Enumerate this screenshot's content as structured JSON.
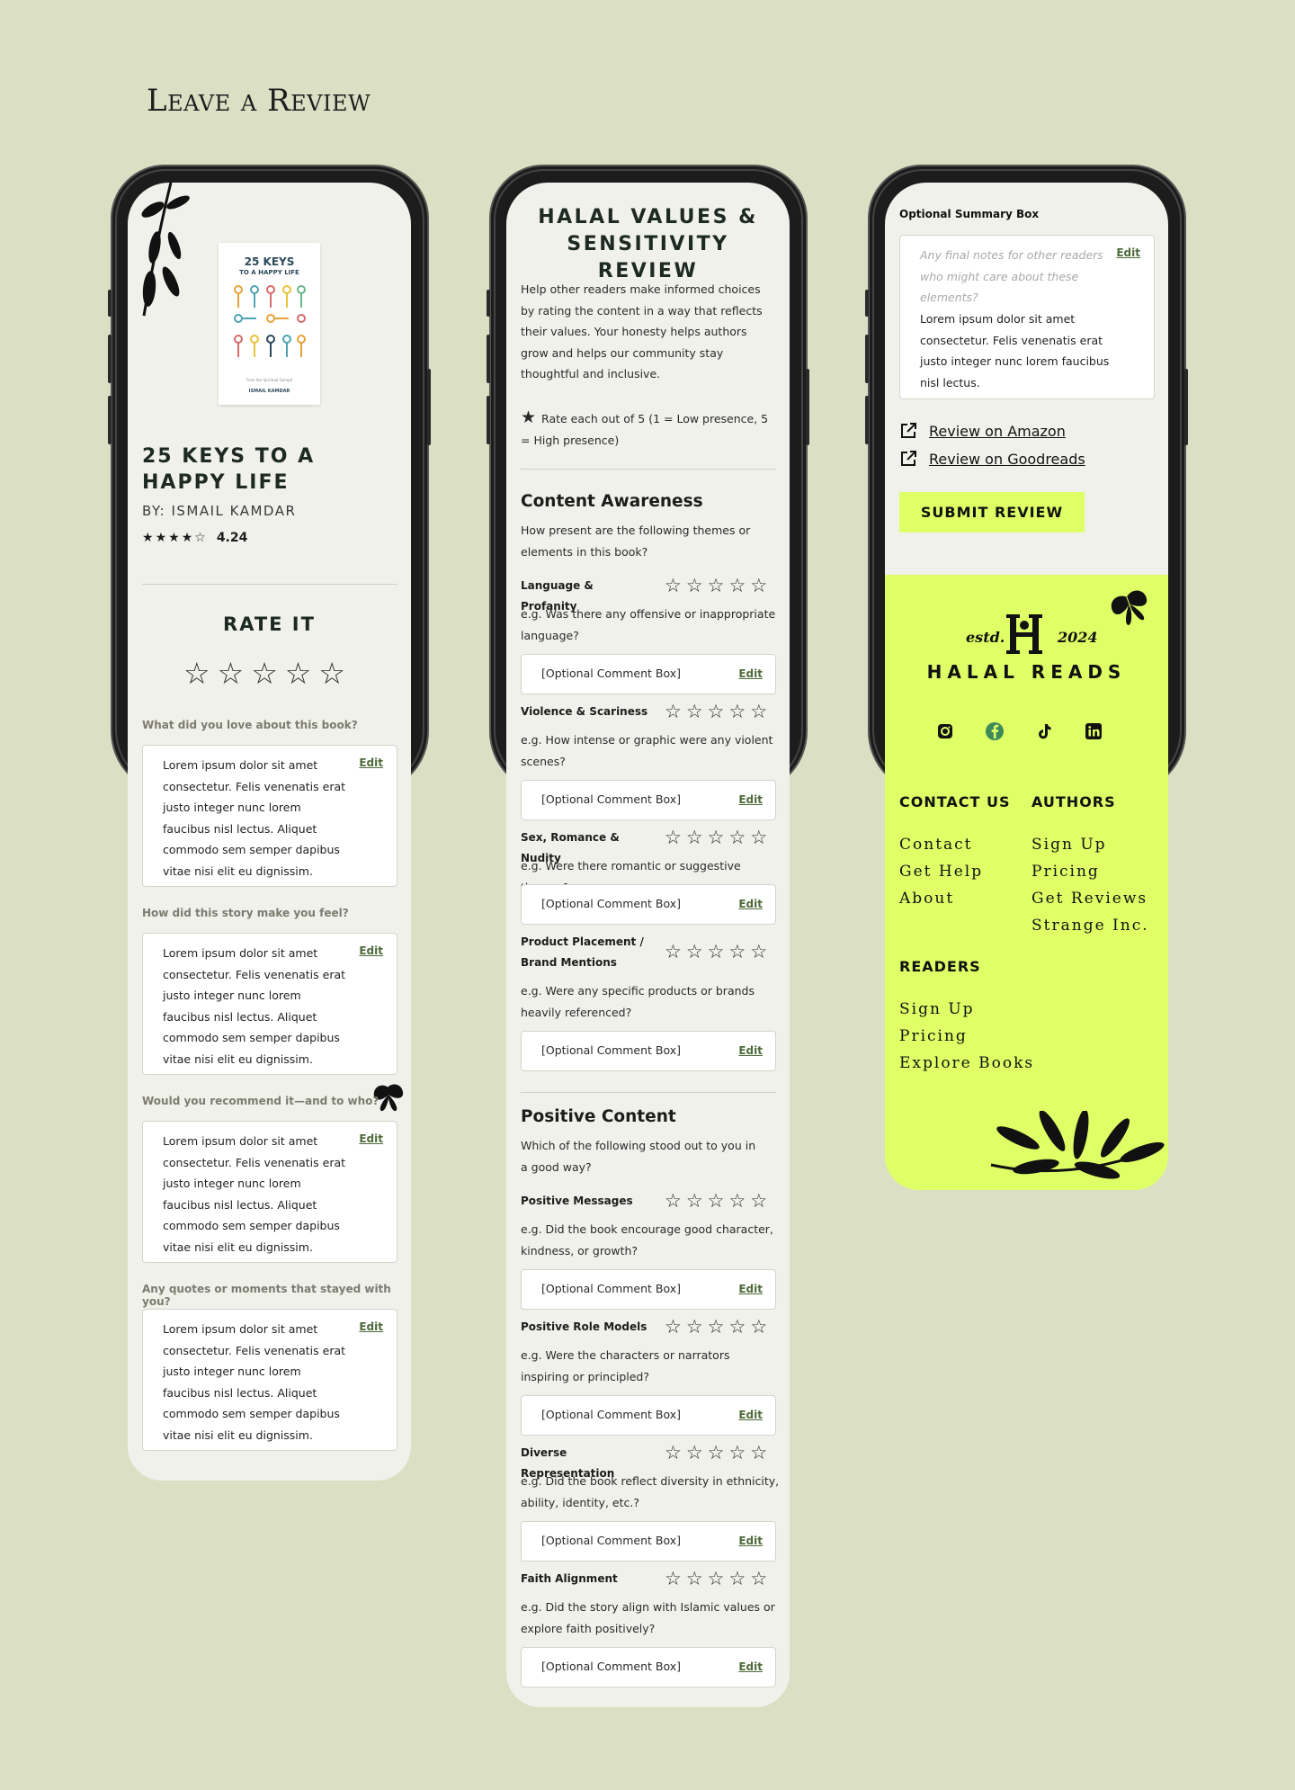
{
  "page": {
    "title": "Leave a Review"
  },
  "screen1": {
    "cover": {
      "title": "25 KEYS",
      "subtitle": "TO A HAPPY LIFE",
      "foot": "From the Spiritual Gumpti",
      "author": "ISMAIL KAMDAR"
    },
    "book": {
      "title": "25 KEYS TO A HAPPY LIFE",
      "author": "BY: ISMAIL KAMDAR",
      "rating_value": "4.24",
      "rating_stars": 4.24
    },
    "rate_heading": "RATE IT",
    "questions": [
      {
        "label": "What did you love about this book?",
        "answer": "Lorem ipsum dolor sit amet consectetur. Felis venenatis erat justo integer nunc lorem faucibus nisl lectus. Aliquet commodo sem semper dapibus vitae nisi elit eu dignissim.",
        "edit": "Edit"
      },
      {
        "label": "How did this story make you feel?",
        "answer": "Lorem ipsum dolor sit amet consectetur. Felis venenatis erat justo integer nunc lorem faucibus nisl lectus. Aliquet commodo sem semper dapibus vitae nisi elit eu dignissim.",
        "edit": "Edit"
      },
      {
        "label": "Would you recommend it—and to who?",
        "answer": "Lorem ipsum dolor sit amet consectetur. Felis venenatis erat justo integer nunc lorem faucibus nisl lectus. Aliquet commodo sem semper dapibus vitae nisi elit eu dignissim.",
        "edit": "Edit"
      },
      {
        "label": "Any quotes or moments that stayed with you?",
        "answer": "Lorem ipsum dolor sit amet consectetur. Felis venenatis erat justo integer nunc lorem faucibus nisl lectus. Aliquet commodo sem semper dapibus vitae nisi elit eu dignissim.",
        "edit": "Edit"
      }
    ]
  },
  "screen2": {
    "heading": "HALAL VALUES & SENSITIVITY REVIEW",
    "intro": "Help other readers make informed choices by rating the content in a way that reflects their values. Your honesty helps authors grow and helps our community stay thoughtful and inclusive.",
    "rate_note": "Rate each out of 5 (1 = Low presence, 5 = High presence)",
    "sections": [
      {
        "title": "Content Awareness",
        "subtitle": "How present are the following themes or elements in this book?",
        "criteria": [
          {
            "label": "Language & Profanity",
            "example": "e.g. Was there any offensive or inappropriate language?",
            "comment": "[Optional Comment Box]",
            "edit": "Edit"
          },
          {
            "label": "Violence & Scariness",
            "example": "e.g. How intense or graphic were any violent scenes?",
            "comment": "[Optional Comment Box]",
            "edit": "Edit"
          },
          {
            "label": "Sex, Romance & Nudity",
            "example": "e.g. Were there romantic or suggestive themes?",
            "comment": "[Optional Comment Box]",
            "edit": "Edit"
          },
          {
            "label": "Product Placement / Brand Mentions",
            "example": "e.g. Were any specific products or brands heavily referenced?",
            "comment": "[Optional Comment Box]",
            "edit": "Edit"
          }
        ]
      },
      {
        "title": "Positive Content",
        "subtitle": "Which of the following stood out to you in a good way?",
        "criteria": [
          {
            "label": "Positive Messages",
            "example": "e.g. Did the book encourage good character, kindness, or growth?",
            "comment": "[Optional Comment Box]",
            "edit": "Edit"
          },
          {
            "label": "Positive Role Models",
            "example": "e.g. Were the characters or narrators inspiring or principled?",
            "comment": "[Optional Comment Box]",
            "edit": "Edit"
          },
          {
            "label": "Diverse Representation",
            "example": "e.g. Did the book reflect diversity in ethnicity, ability, identity, etc.?",
            "comment": "[Optional Comment Box]",
            "edit": "Edit"
          },
          {
            "label": "Faith Alignment",
            "example": "e.g. Did the story align with Islamic values or explore faith positively?",
            "comment": "[Optional Comment Box]",
            "edit": "Edit"
          }
        ]
      }
    ]
  },
  "screen3": {
    "summary_label": "Optional Summary Box",
    "summary_placeholder": "Any final notes for other readers who might care about these elements?",
    "summary_text": "Lorem ipsum dolor sit amet consectetur. Felis venenatis erat justo integer nunc lorem faucibus nisl lectus.",
    "summary_edit": "Edit",
    "links": [
      "Review on Amazon",
      "Review on Goodreads"
    ],
    "submit": "SUBMIT REVIEW",
    "footer": {
      "estd": "estd.",
      "year": "2024",
      "brand": "HALAL READS",
      "socials": [
        "instagram-icon",
        "facebook-icon",
        "tiktok-icon",
        "linkedin-icon"
      ],
      "contact_title": "CONTACT US",
      "contact_links": [
        "Contact",
        "Get Help",
        "About"
      ],
      "authors_title": "AUTHORS",
      "authors_links": [
        "Sign Up",
        "Pricing",
        "Get Reviews",
        "Strange Inc."
      ],
      "readers_title": "READERS",
      "readers_links": [
        "Sign Up",
        "Pricing",
        "Explore Books"
      ]
    }
  },
  "colors": {
    "background": "#dbdfc4",
    "screen": "#f1f1eb",
    "accent": "#dfff66",
    "edit_link": "#4d6b3a",
    "heading": "#1d2a22"
  }
}
